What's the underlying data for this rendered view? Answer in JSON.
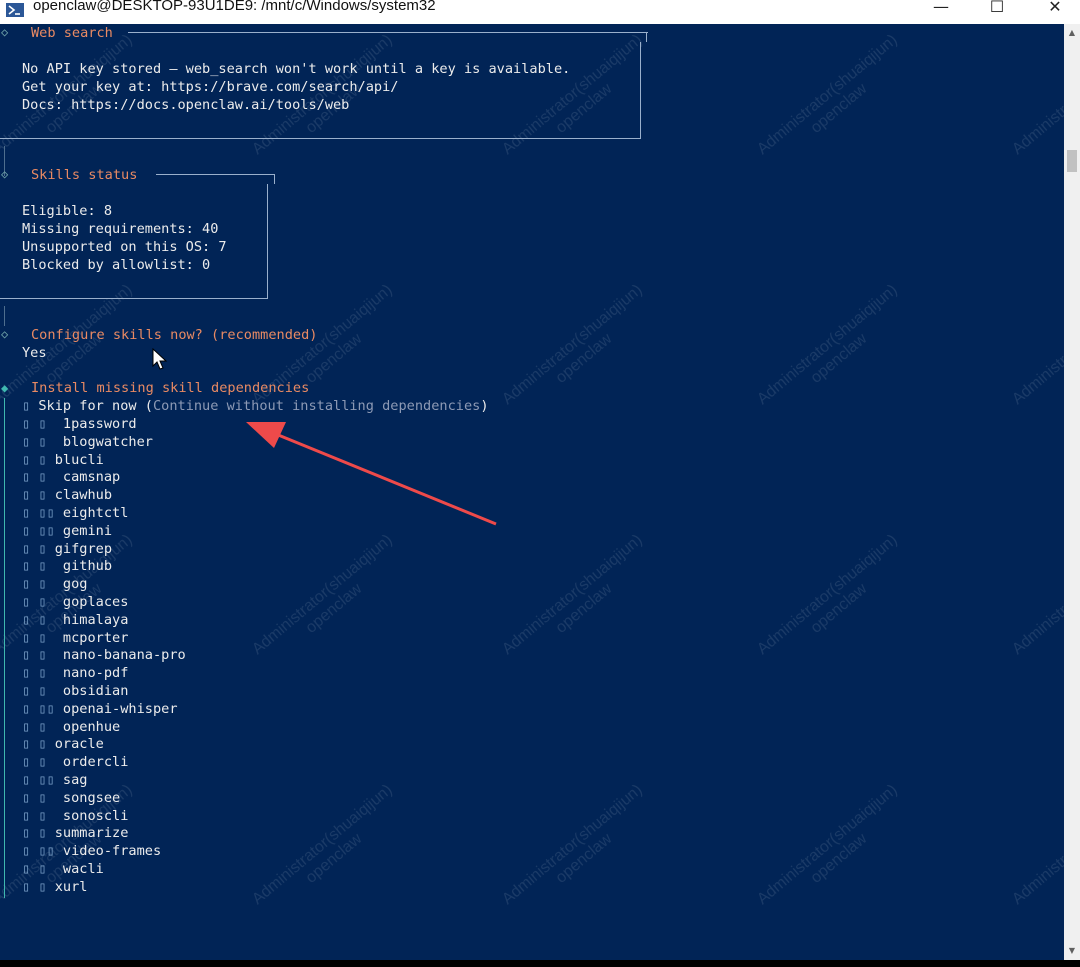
{
  "window": {
    "title": "openclaw@DESKTOP-93U1DE9: /mnt/c/Windows/system32",
    "minimize_glyph": "—",
    "maximize_glyph": "☐",
    "close_glyph": "✕"
  },
  "web_search": {
    "title": "Web search",
    "lines": [
      "No API key stored — web_search won't work until a key is available.",
      "Get your key at: https://brave.com/search/api/",
      "Docs: https://docs.openclaw.ai/tools/web"
    ]
  },
  "skills_status": {
    "title": "Skills status",
    "lines": [
      "Eligible: 8",
      "Missing requirements: 40",
      "Unsupported on this OS: 7",
      "Blocked by allowlist: 0"
    ]
  },
  "configure": {
    "question": "Configure skills now? (recommended)",
    "answer": "Yes"
  },
  "install": {
    "title": "Install missing skill dependencies",
    "skip_label": "Skip for now (",
    "skip_hint": "Continue without installing dependencies",
    "skip_close": ")",
    "box_glyph": "▯",
    "skills": [
      {
        "prefix": "▯ ▯  ",
        "name": "1password"
      },
      {
        "prefix": "▯ ▯  ",
        "name": "blogwatcher"
      },
      {
        "prefix": "▯ ▯ ",
        "name": "blucli"
      },
      {
        "prefix": "▯ ▯  ",
        "name": "camsnap"
      },
      {
        "prefix": "▯ ▯ ",
        "name": "clawhub"
      },
      {
        "prefix": "▯ ▯▯ ",
        "name": "eightctl"
      },
      {
        "prefix": "▯ ▯▯ ",
        "name": "gemini"
      },
      {
        "prefix": "▯ ▯ ",
        "name": "gifgrep"
      },
      {
        "prefix": "▯ ▯  ",
        "name": "github"
      },
      {
        "prefix": "▯ ▯  ",
        "name": "gog"
      },
      {
        "prefix": "▯ ▯  ",
        "name": "goplaces"
      },
      {
        "prefix": "▯ ▯  ",
        "name": "himalaya"
      },
      {
        "prefix": "▯ ▯  ",
        "name": "mcporter"
      },
      {
        "prefix": "▯ ▯  ",
        "name": "nano-banana-pro"
      },
      {
        "prefix": "▯ ▯  ",
        "name": "nano-pdf"
      },
      {
        "prefix": "▯ ▯  ",
        "name": "obsidian"
      },
      {
        "prefix": "▯ ▯▯ ",
        "name": "openai-whisper"
      },
      {
        "prefix": "▯ ▯  ",
        "name": "openhue"
      },
      {
        "prefix": "▯ ▯ ",
        "name": "oracle"
      },
      {
        "prefix": "▯ ▯  ",
        "name": "ordercli"
      },
      {
        "prefix": "▯ ▯▯ ",
        "name": "sag"
      },
      {
        "prefix": "▯ ▯  ",
        "name": "songsee"
      },
      {
        "prefix": "▯ ▯  ",
        "name": "sonoscli"
      },
      {
        "prefix": "▯ ▯ ",
        "name": "summarize"
      },
      {
        "prefix": "▯ ▯▯ ",
        "name": "video-frames"
      },
      {
        "prefix": "▯ ▯  ",
        "name": "wacli"
      },
      {
        "prefix": "▯ ▯ ",
        "name": "xurl"
      }
    ]
  },
  "watermark": {
    "line1": "Administrator(shuaiqijun)",
    "line2": "openclaw"
  },
  "icons": {
    "terminal": "powershell-terminal-icon",
    "pointer": "mouse-pointer-icon",
    "annotation": "red-arrow-annotation"
  },
  "colors": {
    "terminal_bg": "#012456",
    "section_title": "#e98a63",
    "text": "#ececec",
    "annotation": "#ee4a4a"
  }
}
